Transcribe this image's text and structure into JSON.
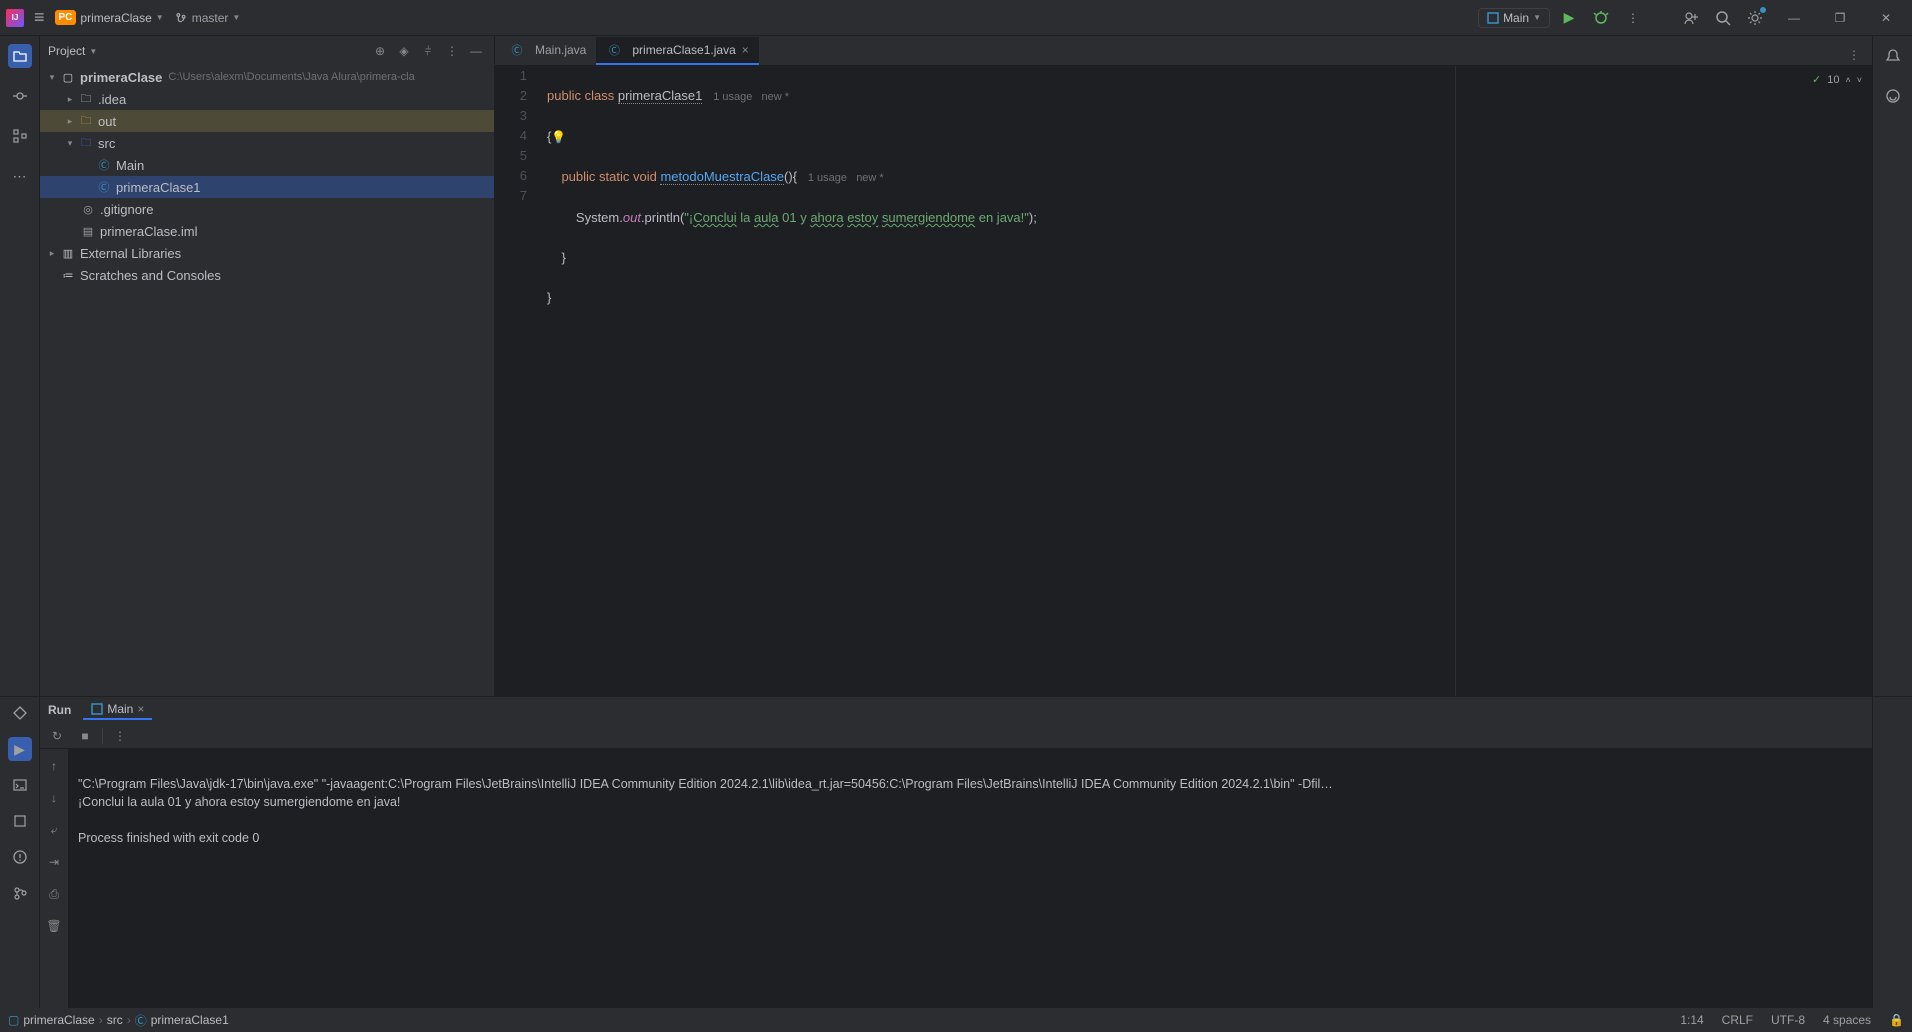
{
  "titlebar": {
    "project_badge": "PC",
    "project_name": "primeraClase",
    "branch": "master",
    "run_config": "Main"
  },
  "icons": {
    "menu": "☰",
    "search": "🔍",
    "gear": "⚙",
    "person": "◯",
    "minimize": "—",
    "maximize": "❐",
    "close": "✕",
    "more": "⋮",
    "play": "▶",
    "debug": "⚙",
    "bell": "🔔",
    "ai": "⊞"
  },
  "project_panel": {
    "title": "Project",
    "root_name": "primeraClase",
    "root_path": "C:\\Users\\alexm\\Documents\\Java Alura\\primera-cla",
    "idea": ".idea",
    "out": "out",
    "src": "src",
    "main": "Main",
    "pc1": "primeraClase1",
    "gitignore": ".gitignore",
    "iml": "primeraClase.iml",
    "extlib": "External Libraries",
    "scratch": "Scratches and Consoles"
  },
  "tabs": {
    "main": "Main.java",
    "pc1": "primeraClase1.java"
  },
  "editor": {
    "l1_kw1": "public",
    "l1_kw2": "class",
    "l1_cls": "primeraClase1",
    "l1_hint": "1 usage   new *",
    "l2": "{",
    "l3_kw": "public static void",
    "l3_mth": "metodoMuestraClase",
    "l3_paren": "(){",
    "l3_hint": "1 usage   new *",
    "l4_a": "        System.",
    "l4_out": "out",
    "l4_b": ".println(",
    "l4_s1": "\"¡",
    "l4_u1": "Conclui",
    "l4_s2": " la ",
    "l4_u2": "aula",
    "l4_s3": " 01 y ",
    "l4_u3": "ahora",
    "l4_s4": " ",
    "l4_u4": "estoy",
    "l4_s5": " ",
    "l4_u5": "sumergiendome",
    "l4_s6": " en java!\"",
    "l4_c": ");",
    "l5": "    }",
    "l6": "}",
    "inspections": "10"
  },
  "run": {
    "tab_label": "Run",
    "config": "Main",
    "console_l1": "\"C:\\Program Files\\Java\\jdk-17\\bin\\java.exe\" \"-javaagent:C:\\Program Files\\JetBrains\\IntelliJ IDEA Community Edition 2024.2.1\\lib\\idea_rt.jar=50456:C:\\Program Files\\JetBrains\\IntelliJ IDEA Community Edition 2024.2.1\\bin\" -Dfil…",
    "console_l2": "¡Conclui la aula 01 y ahora estoy sumergiendome en java!",
    "console_l3": "",
    "console_l4": "Process finished with exit code 0"
  },
  "statusbar": {
    "crumb1": "primeraClase",
    "crumb2": "src",
    "crumb3": "primeraClase1",
    "pos": "1:14",
    "eol": "CRLF",
    "enc": "UTF-8",
    "indent": "4 spaces"
  }
}
